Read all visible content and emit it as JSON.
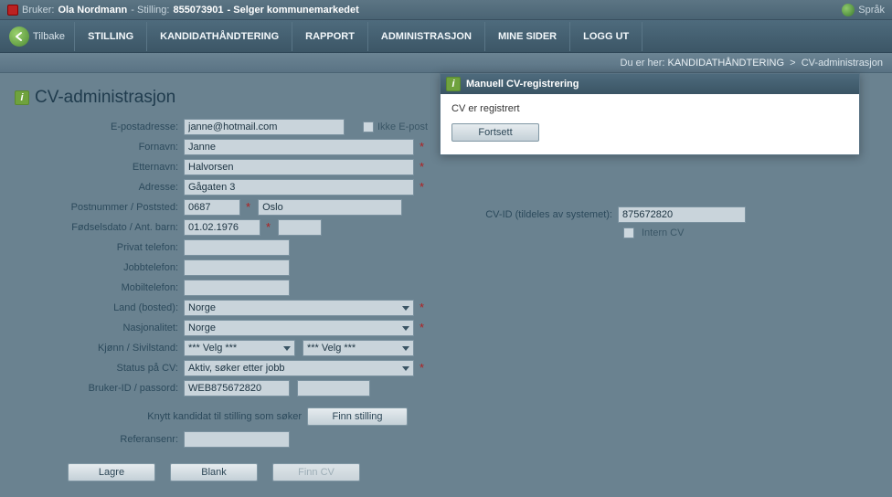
{
  "topbar": {
    "user_label": "Bruker:",
    "user_name": "Ola Nordmann",
    "pos_label": "- Stilling:",
    "pos_id": "855073901",
    "pos_title": "- Selger kommunemarkedet",
    "lang_label": "Språk"
  },
  "nav": {
    "back": "Tilbake",
    "tabs": [
      "STILLING",
      "KANDIDATHÅNDTERING",
      "RAPPORT",
      "ADMINISTRASJON",
      "MINE SIDER",
      "LOGG UT"
    ]
  },
  "breadcrumb": {
    "prefix": "Du er her:",
    "link": "KANDIDATHÅNDTERING",
    "sep": ">",
    "current": "CV-administrasjon"
  },
  "page_title": "CV-administrasjon",
  "labels": {
    "email": "E-postadresse:",
    "no_email": "Ikke E-post",
    "fornavn": "Fornavn:",
    "etternavn": "Etternavn:",
    "adresse": "Adresse:",
    "postnr": "Postnummer / Poststed:",
    "fodsel": "Fødselsdato / Ant. barn:",
    "privtel": "Privat telefon:",
    "jobbtel": "Jobbtelefon:",
    "mobtel": "Mobiltelefon:",
    "land": "Land (bosted):",
    "nasj": "Nasjonalitet:",
    "kjonn": "Kjønn / Sivilstand:",
    "status": "Status på CV:",
    "brukerid": "Bruker-ID / passord:",
    "knytt": "Knytt kandidat til stilling som søker",
    "referanse": "Referansenr:",
    "cvid": "CV-ID (tildeles av systemet):",
    "intern": "Intern CV"
  },
  "values": {
    "email": "janne@hotmail.com",
    "fornavn": "Janne",
    "etternavn": "Halvorsen",
    "adresse": "Gågaten 3",
    "postnr": "0687",
    "poststed": "Oslo",
    "fodsel": "01.02.1976",
    "ant_barn": "",
    "privtel": "",
    "jobbtel": "",
    "mobtel": "",
    "land": "Norge",
    "nasj": "Norge",
    "kjonn": "*** Velg ***",
    "sivil": "*** Velg ***",
    "status": "Aktiv, søker etter jobb",
    "brukerid": "WEB875672820",
    "passord": "",
    "referanse": "",
    "cvid": "875672820"
  },
  "buttons": {
    "finn_stilling": "Finn stilling",
    "lagre": "Lagre",
    "blank": "Blank",
    "finn_cv": "Finn CV",
    "fortsett": "Fortsett"
  },
  "modal": {
    "title": "Manuell CV-registrering",
    "message": "CV er registrert"
  }
}
